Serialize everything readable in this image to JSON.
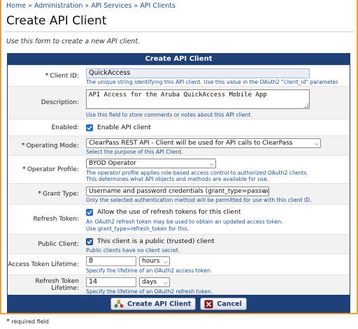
{
  "breadcrumb": [
    {
      "label": "Home"
    },
    {
      "label": "Administration"
    },
    {
      "label": "API Services"
    },
    {
      "label": "API Clients"
    }
  ],
  "breadcrumb_sep": "»",
  "page_title": "Create API Client",
  "intro": "Use this form to create a new API client.",
  "form": {
    "header": "Create API Client",
    "client_id": {
      "label": "Client ID:",
      "value": "QuickAccess",
      "hint": "The unique string identifying this API client. Use this value in the OAuth2 \"client_id\" parameter."
    },
    "description": {
      "label": "Description:",
      "value": "API Access for the Aruba QuickAccess Mobile App",
      "hint": "Use this field to store comments or notes about this API client."
    },
    "enabled": {
      "label": "Enabled:",
      "checkbox_label": "Enable API client",
      "checked": true
    },
    "operating_mode": {
      "label": "Operating Mode:",
      "value": "ClearPass REST API - Client will be used for API calls to ClearPass",
      "hint": "Select the purpose of this API Client."
    },
    "operator_profile": {
      "label": "Operator Profile:",
      "value": "BYOD Operator",
      "hint1": "The operator profile applies role-based access control to authorized OAuth2 clients.",
      "hint2": "This determines what API objects and methods are available for use."
    },
    "grant_type": {
      "label": "Grant Type:",
      "value": "Username and password credentials (grant_type=password)",
      "hint": "Only the selected authentication method will be permitted for use with this client ID."
    },
    "refresh_token": {
      "label": "Refresh Token:",
      "checkbox_label": "Allow the use of refresh tokens for this client",
      "checked": true,
      "hint1": "An OAuth2 refresh token may be used to obtain an updated access token.",
      "hint2": "Use grant_type=refresh_token for this."
    },
    "public_client": {
      "label": "Public Client:",
      "checkbox_label": "This client is a public (trusted) client",
      "checked": true,
      "hint": "Public clients have no client secret."
    },
    "access_token_lifetime": {
      "label": "Access Token Lifetime:",
      "value": "8",
      "unit": "hours",
      "hint": "Specify the lifetime of an OAuth2 access token."
    },
    "refresh_token_lifetime": {
      "label": "Refresh Token Lifetime:",
      "value": "14",
      "unit": "days",
      "hint": "Specify the lifetime of an OAuth2 refresh token."
    },
    "required_marker": "*",
    "buttons": {
      "create": "Create API Client",
      "cancel": "Cancel"
    }
  },
  "footnote": "required field",
  "colors": {
    "header_bg": "#1d3f7a",
    "link": "#1a4f9c",
    "checkbox": "#1f6fd6",
    "frame_border": "#f0a030"
  },
  "icons": {
    "create": "api-client-add-icon",
    "cancel": "cancel-icon",
    "select": "chevron-down-icon",
    "check": "checkmark-icon"
  }
}
